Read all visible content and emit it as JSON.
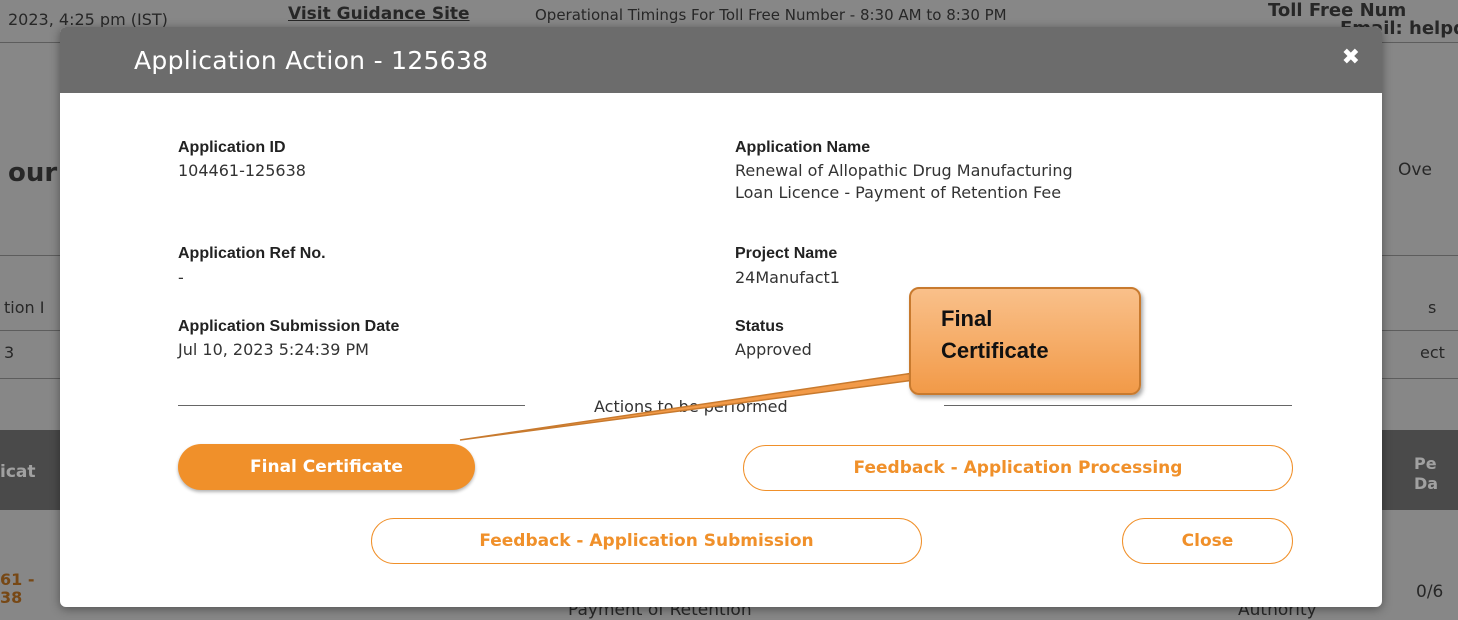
{
  "background": {
    "top_left_text": "2023, 4:25 pm (IST)",
    "guidance_link": "Visit Guidance Site",
    "timings_text": "Operational Timings For Toll Free Number - 8:30 AM to 8:30 PM",
    "right_header_text_1": "Toll Free Num",
    "right_header_text_2": "Email: helpde",
    "left_heading_partial": "our",
    "right_tab_partial": "Ove",
    "left_col_partial": "tion I",
    "right_col_partial": "s",
    "left_row_partial": "3",
    "right_row_partial": "ect",
    "left_table_header_partial": "icat",
    "right_table_header_partial_1": "Pe",
    "right_table_header_partial_2": "Da",
    "left_bottom_id_1": "61 -",
    "left_bottom_id_2": "38",
    "bottom_center_partial": "Payment of Retention",
    "bottom_right_partial": "Authority",
    "far_right_partial": "0/6"
  },
  "modal": {
    "title": "Application Action - 125638",
    "close_icon": "close-icon",
    "fields": {
      "application_id_label": "Application ID",
      "application_id_value": "104461-125638",
      "application_name_label": "Application Name",
      "application_name_line1": "Renewal of Allopathic Drug Manufacturing",
      "application_name_line2": "Loan Licence - Payment of Retention Fee",
      "ref_no_label": "Application Ref No.",
      "ref_no_value": "-",
      "project_name_label": "Project Name",
      "project_name_value": "24Manufact1",
      "submission_date_label": "Application Submission Date",
      "submission_date_value": "Jul 10, 2023 5:24:39 PM",
      "status_label": "Status",
      "status_value": "Approved"
    },
    "actions_label": "Actions to be performed",
    "buttons": {
      "final_certificate": "Final Certificate",
      "feedback_processing": "Feedback - Application Processing",
      "feedback_submission": "Feedback - Application Submission",
      "close": "Close"
    }
  },
  "callout": {
    "line1": "Final",
    "line2": "Certificate"
  },
  "colors": {
    "accent": "#f0902a",
    "header": "#6c6c6c",
    "callout_fill": "#f29a48"
  }
}
